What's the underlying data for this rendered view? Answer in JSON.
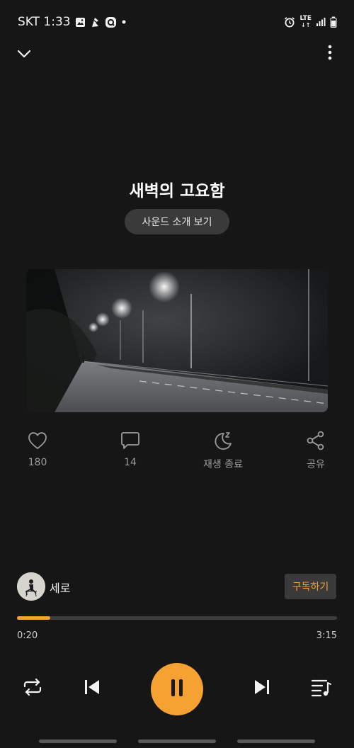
{
  "status_bar": {
    "carrier_time": "SKT 1:33",
    "network": "LTE",
    "icons": [
      "gallery-icon",
      "satellite-icon",
      "app-notification-icon",
      "dot-icon",
      "alarm-icon",
      "signal-icon",
      "battery-icon"
    ]
  },
  "header": {
    "collapse_icon": "chevron-down-icon",
    "more_icon": "more-vertical-icon"
  },
  "track": {
    "title": "새벽의 고요함",
    "intro_button": "사운드 소개 보기",
    "cover_description_icon": "album-cover"
  },
  "actions": {
    "like_count": "180",
    "comment_count": "14",
    "sleep_label": "재생 종료",
    "share_label": "공유"
  },
  "artist": {
    "name": "세로",
    "subscribe_label": "구독하기"
  },
  "player": {
    "elapsed": "0:20",
    "total": "3:15",
    "progress_fraction": 0.103,
    "accent_color": "#f5a232"
  }
}
